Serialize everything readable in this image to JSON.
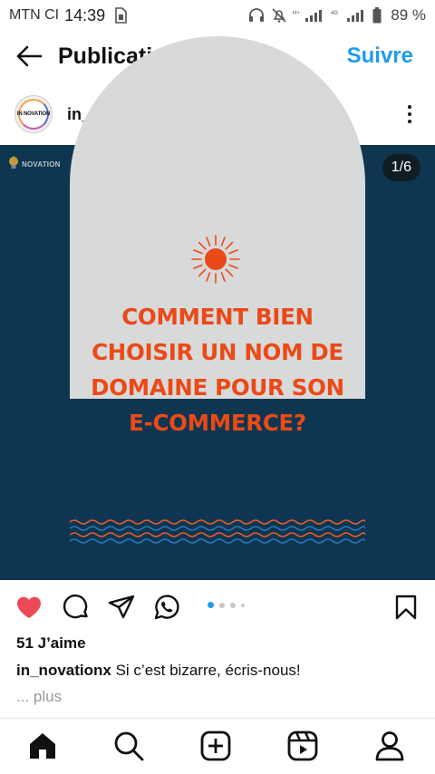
{
  "status_bar": {
    "carrier": "MTN CI",
    "time": "14:39",
    "battery_pct": "89 %",
    "network_small_1": "H+",
    "network_small_2": "4G"
  },
  "header": {
    "title": "Publications",
    "follow_label": "Suivre"
  },
  "post": {
    "username": "in_novationx",
    "avatar_text": "IN NOVATION",
    "brand_mark_text": "NOVATION",
    "counter": "1/6",
    "headline_lines": [
      "COMMENT BIEN",
      "CHOISIR UN NOM DE",
      "DOMAINE POUR SON",
      "E-COMMERCE?"
    ],
    "likes": "51 J’aime",
    "caption_user": "in_novationx",
    "caption_text": " Si c’est bizarre, écris-nous!",
    "more_label": "... plus",
    "carousel": {
      "current": 1,
      "total": 6
    }
  },
  "colors": {
    "accent": "#1e9bf0",
    "like": "#ed4956",
    "media_bg": "#0e3650",
    "arch": "#d8d9d9",
    "headline": "#ea4a17"
  },
  "icons": {
    "back": "arrow-left-icon",
    "more": "more-vertical-icon",
    "like": "heart-filled-icon",
    "comment": "comment-icon",
    "share": "send-icon",
    "whatsapp": "whatsapp-icon",
    "save": "bookmark-icon",
    "nav": [
      "home-icon",
      "search-icon",
      "create-icon",
      "reels-icon",
      "profile-icon"
    ]
  }
}
